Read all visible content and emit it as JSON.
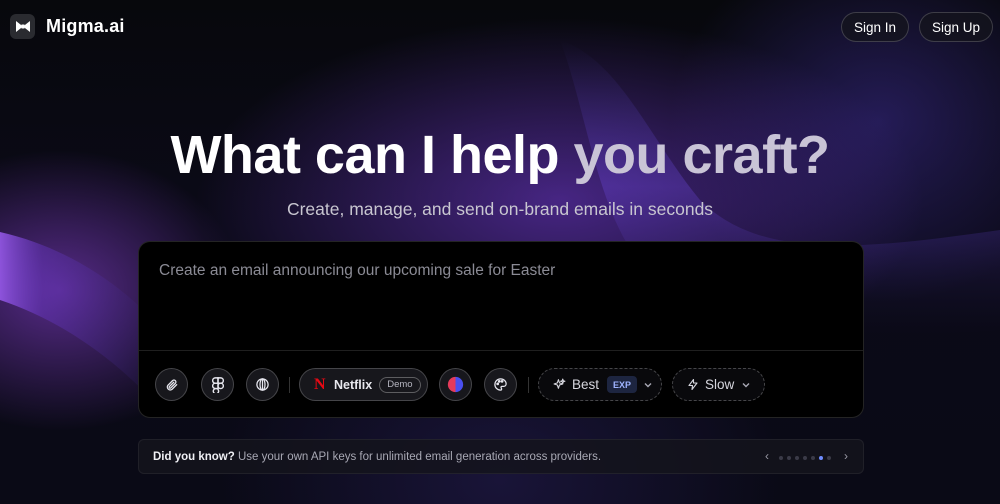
{
  "header": {
    "brand": "Migma.ai",
    "logo_icon": "bowtie-logo-icon",
    "sign_in": "Sign In",
    "sign_up": "Sign Up"
  },
  "hero": {
    "title_part1": "What can I help ",
    "title_part2": "you craft?",
    "subtitle": "Create, manage, and send on-brand emails in seconds"
  },
  "composer": {
    "prompt_placeholder": "Create an email announcing our upcoming sale for Easter",
    "prompt_value": "",
    "tools": [
      {
        "icon": "paperclip-icon"
      },
      {
        "icon": "figma-icon"
      },
      {
        "icon": "globe-icon"
      }
    ],
    "brand_selector": {
      "name": "Netflix",
      "badge": "Demo",
      "icon": "netflix-logo-icon"
    },
    "color_icon": "color-split-icon",
    "palette_icon": "palette-icon",
    "quality": {
      "label": "Best",
      "badge": "EXP",
      "icon": "sparkles-icon"
    },
    "speed": {
      "label": "Slow",
      "icon": "lightning-icon"
    }
  },
  "tip": {
    "lead": "Did you know?",
    "text": " Use your own API keys for unlimited email generation across providers.",
    "prev": "‹",
    "next": "›",
    "total": 7,
    "active_index": 5
  },
  "colors": {
    "netflix_red": "#e50914",
    "accent_blue": "#6f8cff",
    "purple_glow": "#7b3fe0"
  }
}
